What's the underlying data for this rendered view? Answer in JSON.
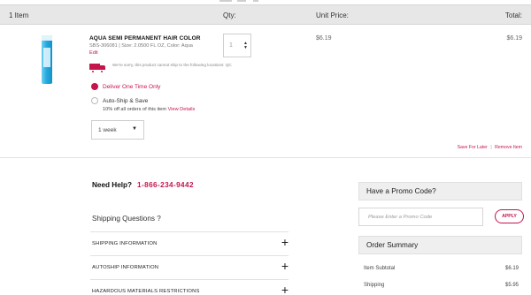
{
  "cart_header": {
    "items": "1 Item",
    "qty": "Qty:",
    "unit_price": "Unit Price:",
    "total": "Total:"
  },
  "item": {
    "name": "AQUA SEMI PERMANENT HAIR COLOR",
    "sku_line": "SBS-306081 | Size: 2.0500 FL OZ, Color: Aqua",
    "edit": "Edit",
    "shipping_note": "We're sorry, this product cannot ship to the following locations: QC",
    "quantity": "1",
    "unit_price": "$6.19",
    "total": "$6.19",
    "delivery": {
      "option_once": "Deliver One Time Only",
      "option_autoship": "Auto-Ship & Save",
      "autoship_note": "10% off all orders of this item",
      "view_details": "View Details",
      "selected": "once",
      "frequency": "1 week"
    },
    "save_for_later": "Save For Later",
    "link_separator": "|",
    "remove_item": "Remove Item"
  },
  "help": {
    "label": "Need Help?",
    "phone": "1-866-234-9442",
    "shipping_questions": "Shipping Questions ?",
    "accordion": [
      {
        "label": "SHIPPING INFORMATION",
        "icon": "plus-icon"
      },
      {
        "label": "AUTOSHIP INFORMATION",
        "icon": "plus-icon"
      },
      {
        "label": "HAZARDOUS MATERIALS RESTRICTIONS",
        "icon": "plus-icon"
      }
    ]
  },
  "promo": {
    "title": "Have a Promo Code?",
    "placeholder": "Please Enter a Promo Code",
    "apply": "APPLY"
  },
  "summary": {
    "title": "Order Summary",
    "rows": [
      {
        "label": "Item Subtotal",
        "value": "$6.19"
      },
      {
        "label": "Shipping",
        "value": "$5.95"
      }
    ]
  },
  "colors": {
    "accent": "#c4154c",
    "header_bg": "#e7e7e7",
    "panel_bg": "#efefef"
  }
}
